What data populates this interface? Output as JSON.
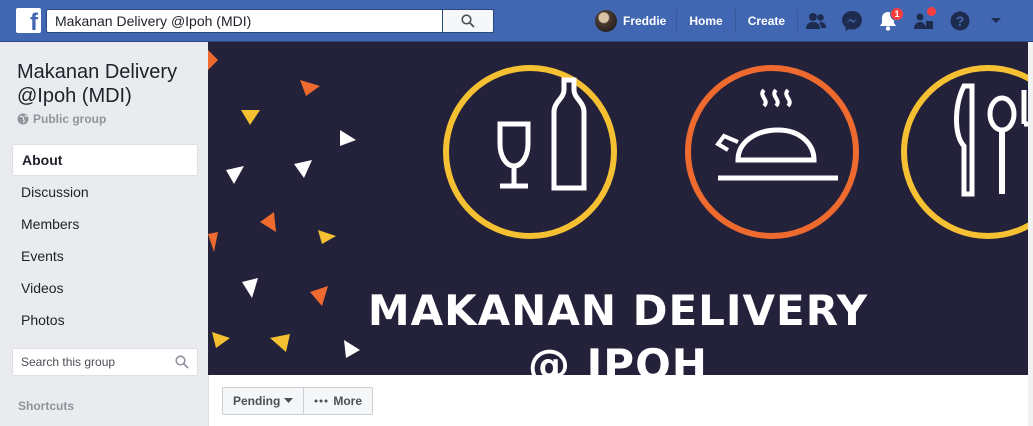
{
  "topbar": {
    "logo_letter": "f",
    "search_value": "Makanan Delivery @Ipoh (MDI)",
    "user_name": "Freddie",
    "home_label": "Home",
    "create_label": "Create",
    "notification_count": "1"
  },
  "sidebar": {
    "group_name": "Makanan Delivery @Ipoh (MDI)",
    "group_type": "Public group",
    "items": [
      {
        "label": "About"
      },
      {
        "label": "Discussion"
      },
      {
        "label": "Members"
      },
      {
        "label": "Events"
      },
      {
        "label": "Videos"
      },
      {
        "label": "Photos"
      }
    ],
    "search_placeholder": "Search this group",
    "shortcuts_label": "Shortcuts"
  },
  "cover": {
    "line1": "MAKANAN DELIVERY",
    "line2": "@ IPOH"
  },
  "actions": {
    "pending_label": "Pending",
    "more_label": "More"
  },
  "colors": {
    "brand": "#4267b2",
    "cover_bg": "#24223b",
    "ring_yellow": "#f5c132",
    "ring_orange": "#ee6a2f"
  }
}
